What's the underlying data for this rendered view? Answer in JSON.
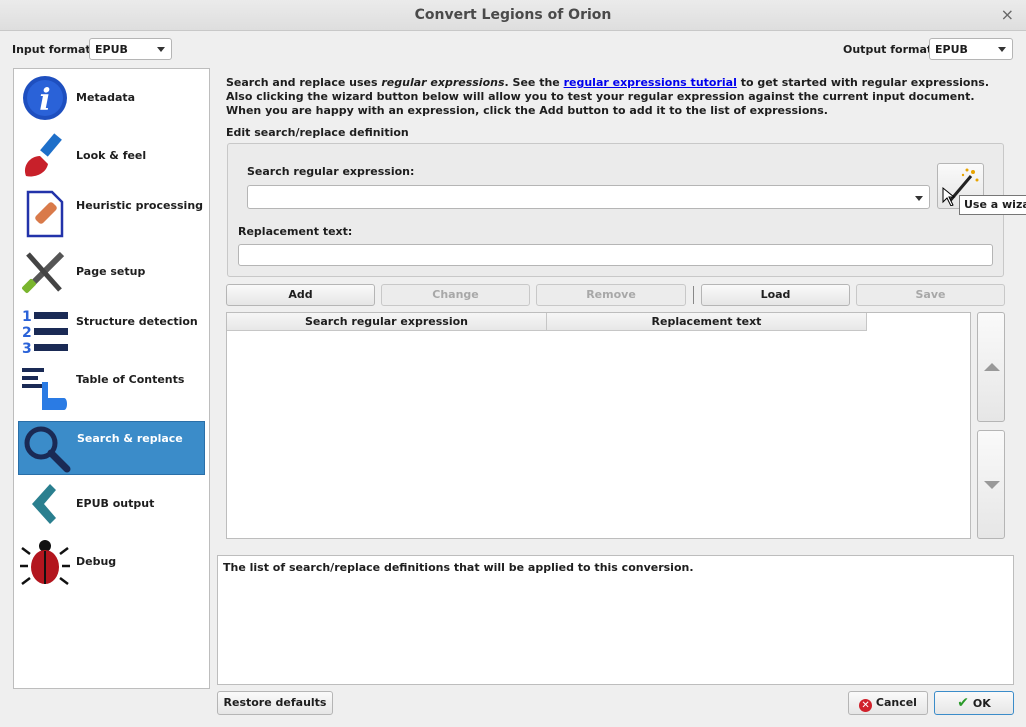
{
  "window": {
    "title": "Convert Legions of Orion",
    "close_glyph": "×"
  },
  "input_format": {
    "label": "Input format:",
    "value": "EPUB"
  },
  "output_format": {
    "label": "Output format:",
    "value": "EPUB"
  },
  "sidebar": {
    "items": [
      {
        "label": "Metadata",
        "icon": "info-icon"
      },
      {
        "label": "Look & feel",
        "icon": "brush-icon"
      },
      {
        "label": "Heuristic processing",
        "icon": "bandage-icon"
      },
      {
        "label": "Page setup",
        "icon": "tools-icon"
      },
      {
        "label": "Structure detection",
        "icon": "numbered-list-icon"
      },
      {
        "label": "Table of Contents",
        "icon": "toc-hand-icon"
      },
      {
        "label": "Search & replace",
        "icon": "magnifier-icon",
        "selected": true
      },
      {
        "label": "EPUB output",
        "icon": "chevron-left-icon"
      },
      {
        "label": "Debug",
        "icon": "bug-icon"
      }
    ]
  },
  "description": {
    "part1": "Search and replace uses ",
    "italic": "regular expressions",
    "part2": ". See the ",
    "link": "regular expressions tutorial",
    "part3": " to get started with regular expressions. Also clicking the wizard button below will allow you to test your regular expression against the current input document. When you are happy with an expression, click the Add button to add it to the list of expressions."
  },
  "edit_group": {
    "title": "Edit search/replace definition",
    "search_label": "Search regular expression:",
    "search_value": "",
    "replace_label": "Replacement text:",
    "replace_value": "",
    "wizard_tooltip": "Use a wizard"
  },
  "actions": {
    "add": "Add",
    "change": "Change",
    "remove": "Remove",
    "load": "Load",
    "save": "Save"
  },
  "table": {
    "columns": [
      "Search regular expression",
      "Replacement text"
    ],
    "rows": []
  },
  "help_text": "The list of search/replace definitions that will be applied to this conversion.",
  "footer": {
    "restore": "Restore defaults",
    "cancel": "Cancel",
    "ok": "OK"
  },
  "colors": {
    "selected_bg": "#3b8cc9",
    "link": "#0000ee"
  }
}
